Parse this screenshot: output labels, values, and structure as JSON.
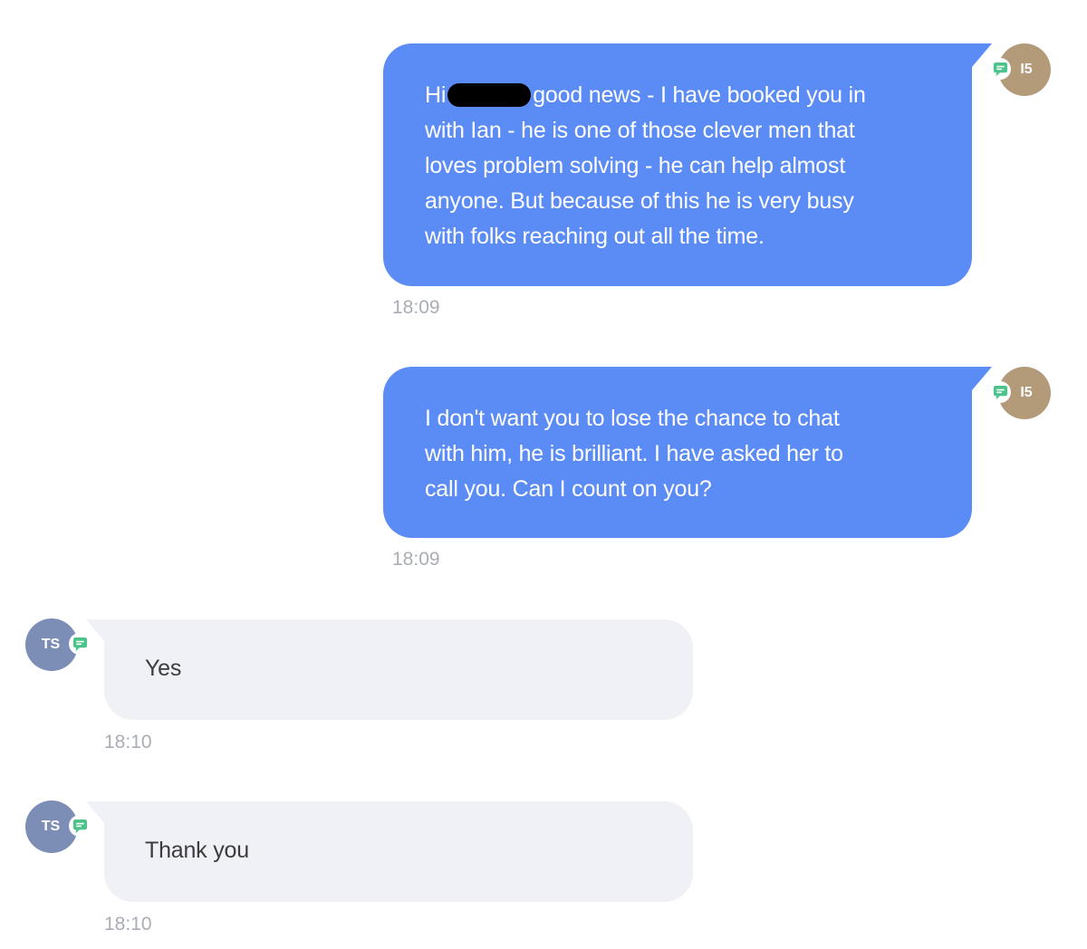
{
  "colors": {
    "outgoing_bubble": "#5b8cf5",
    "incoming_bubble": "#f0f1f7",
    "agent_avatar": "#b39a79",
    "user_avatar": "#7d8eb6",
    "channel_badge": "#4cc38a",
    "timestamp": "#a9adb6"
  },
  "messages": [
    {
      "direction": "outgoing",
      "text_greeting": "Hi",
      "text_body": "good news - I have booked you in\nwith Ian - he is one of those clever men that\nloves problem solving - he can help almost\nanyone. But because of this he is very busy\nwith folks reaching out all the time.",
      "redacted": true,
      "time": "18:09",
      "avatar_initials": "I5",
      "channel_icon": "chat-bubble-icon"
    },
    {
      "direction": "outgoing",
      "text": "I don't want you to lose the chance to chat\nwith him, he is brilliant. I have asked her to\ncall you. Can I count on you?",
      "time": "18:09",
      "avatar_initials": "I5",
      "channel_icon": "chat-bubble-icon"
    },
    {
      "direction": "incoming",
      "text": "Yes",
      "time": "18:10",
      "avatar_initials": "TS",
      "channel_icon": "chat-bubble-icon"
    },
    {
      "direction": "incoming",
      "text": "Thank you",
      "time": "18:10",
      "avatar_initials": "TS",
      "channel_icon": "chat-bubble-icon"
    }
  ]
}
